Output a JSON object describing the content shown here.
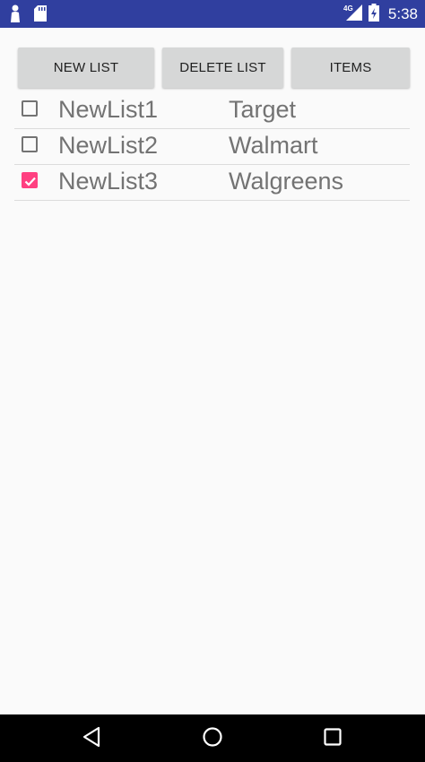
{
  "status_bar": {
    "network_label": "4G",
    "time": "5:38",
    "icons": [
      "person-icon",
      "sd-card-icon",
      "signal-icon",
      "battery-icon"
    ]
  },
  "toolbar": {
    "new_list_label": "NEW LIST",
    "delete_list_label": "DELETE LIST",
    "items_label": "ITEMS"
  },
  "lists": [
    {
      "name": "NewList1",
      "store": "Target",
      "checked": false
    },
    {
      "name": "NewList2",
      "store": "Walmart",
      "checked": false
    },
    {
      "name": "NewList3",
      "store": "Walgreens",
      "checked": true
    }
  ],
  "nav_bar": {
    "icons": [
      "back-icon",
      "home-icon",
      "recents-icon"
    ]
  },
  "colors": {
    "status_bar": "#303f9f",
    "accent": "#ff4081",
    "button_bg": "#d6d7d7",
    "text": "#737373"
  }
}
